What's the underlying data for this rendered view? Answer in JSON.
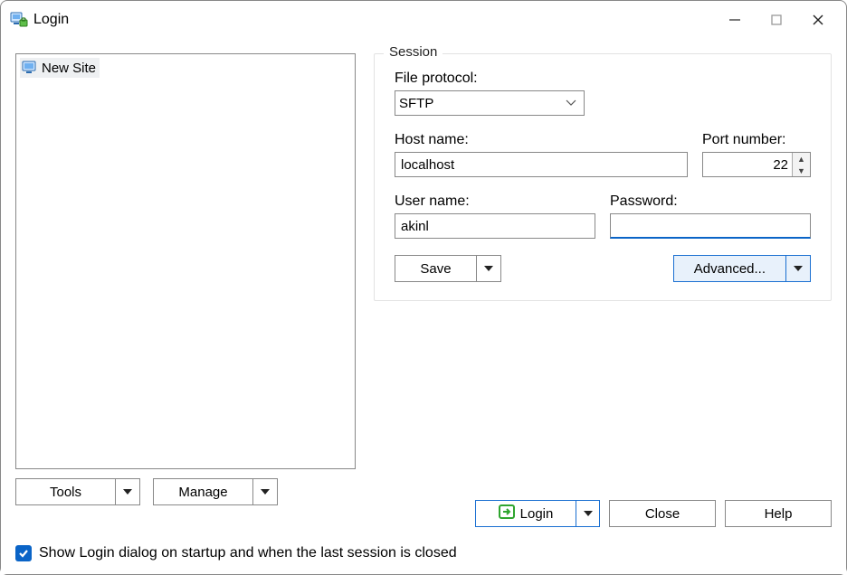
{
  "window": {
    "title": "Login"
  },
  "sites": {
    "items": [
      {
        "label": "New Site"
      }
    ]
  },
  "session": {
    "legend": "Session",
    "protocol_label": "File protocol:",
    "protocol_value": "SFTP",
    "host_label": "Host name:",
    "host_value": "localhost",
    "port_label": "Port number:",
    "port_value": "22",
    "user_label": "User name:",
    "user_value": "akinl",
    "pass_label": "Password:",
    "pass_value": "",
    "save_label": "Save",
    "advanced_label": "Advanced..."
  },
  "sites_buttons": {
    "tools_label": "Tools",
    "manage_label": "Manage"
  },
  "bottom": {
    "login_label": "Login",
    "close_label": "Close",
    "help_label": "Help"
  },
  "checkbox": {
    "label": "Show Login dialog on startup and when the last session is closed",
    "checked": true
  }
}
